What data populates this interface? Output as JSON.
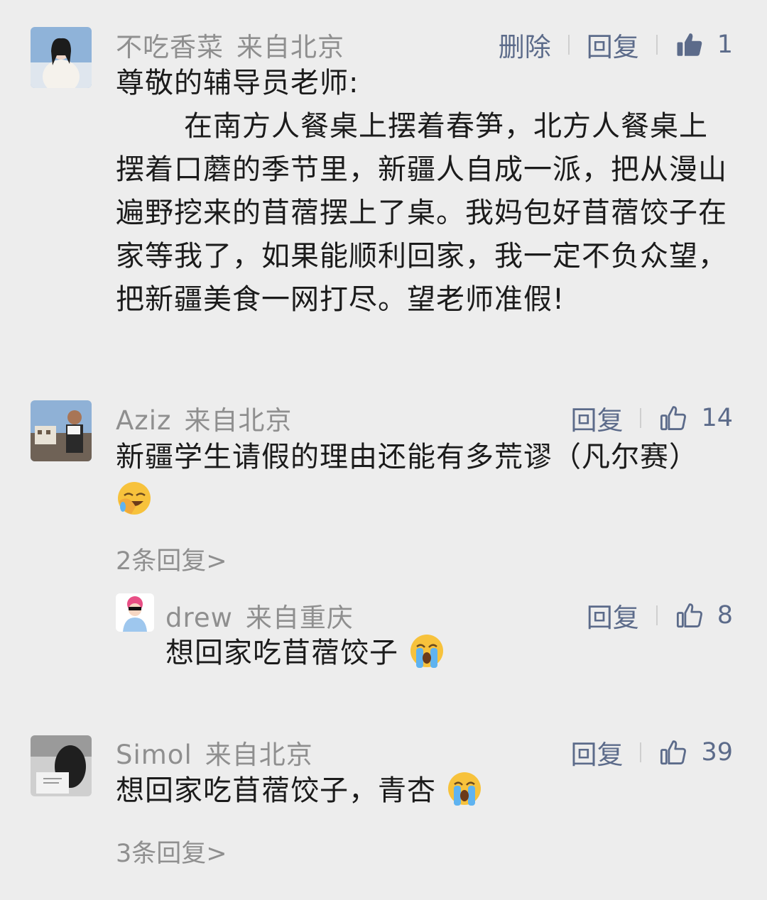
{
  "comments": [
    {
      "username": "不吃香菜",
      "location": "来自北京",
      "delete_label": "删除",
      "reply_label": "回复",
      "likes": "1",
      "greeting": "尊敬的辅导员老师:",
      "body": "在南方人餐桌上摆着春笋，北方人餐桌上摆着口蘑的季节里，新疆人自成一派，把从漫山遍野挖来的苜蓿摆上了桌。我妈包好苜蓿饺子在家等我了，如果能顺利回家，我一定不负众望，把新疆美食一网打尽。望老师准假!"
    },
    {
      "username": "Aziz",
      "location": "来自北京",
      "reply_label": "回复",
      "likes": "14",
      "body": "新疆学生请假的理由还能有多荒谬（凡尔赛）",
      "emoji": "face-palm-laughing",
      "more_replies": "2条回复>",
      "replies": [
        {
          "username": "drew",
          "location": "来自重庆",
          "reply_label": "回复",
          "likes": "8",
          "body": "想回家吃苜蓿饺子",
          "emoji": "loudly-crying-face"
        }
      ]
    },
    {
      "username": "Simol",
      "location": "来自北京",
      "reply_label": "回复",
      "likes": "39",
      "body": "想回家吃苜蓿饺子，青杏",
      "emoji": "loudly-crying-face",
      "more_replies": "3条回复>"
    }
  ],
  "colors": {
    "background": "#ededed",
    "name": "#8f8f8f",
    "action": "#5c6b8a",
    "text": "#1b1b1b"
  }
}
